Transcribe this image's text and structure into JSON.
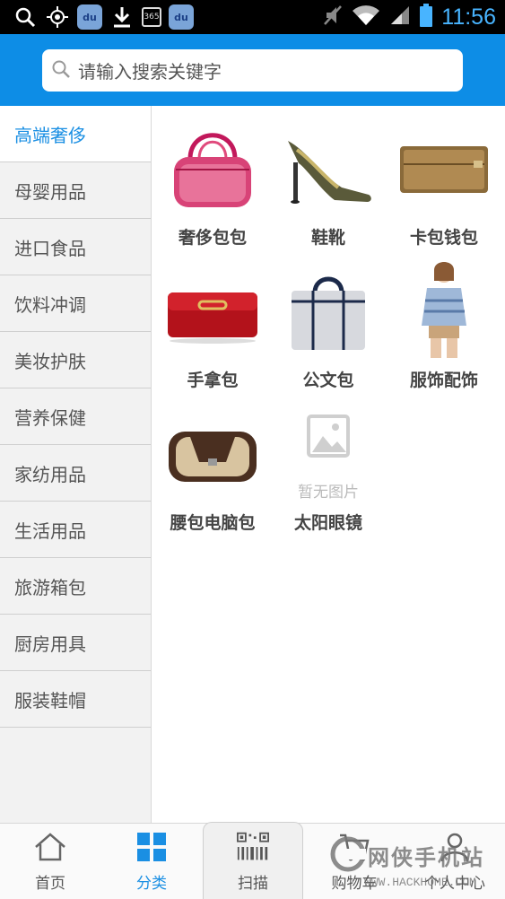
{
  "statusbar": {
    "time": "11:56",
    "calendar_num": "365",
    "baidu_text": "du"
  },
  "search": {
    "placeholder": "请输入搜索关键字"
  },
  "sidebar": {
    "items": [
      {
        "label": "高端奢侈",
        "active": true
      },
      {
        "label": "母婴用品"
      },
      {
        "label": "进口食品"
      },
      {
        "label": "饮料冲调"
      },
      {
        "label": "美妆护肤"
      },
      {
        "label": "营养保健"
      },
      {
        "label": "家纺用品"
      },
      {
        "label": "生活用品"
      },
      {
        "label": "旅游箱包"
      },
      {
        "label": "厨房用具"
      },
      {
        "label": "服装鞋帽"
      }
    ]
  },
  "grid": {
    "items": [
      {
        "label": "奢侈包包",
        "icon": "handbag-image"
      },
      {
        "label": "鞋靴",
        "icon": "high-heel-image"
      },
      {
        "label": "卡包钱包",
        "icon": "wallet-image"
      },
      {
        "label": "手拿包",
        "icon": "clutch-image"
      },
      {
        "label": "公文包",
        "icon": "briefcase-image"
      },
      {
        "label": "服饰配饰",
        "icon": "model-image"
      },
      {
        "label": "腰包电脑包",
        "icon": "waist-bag-image"
      },
      {
        "label": "太阳眼镜",
        "icon": "no-image-placeholder",
        "placeholder_text": "暂无图片"
      }
    ]
  },
  "bottomnav": {
    "items": [
      {
        "label": "首页",
        "icon": "home-icon"
      },
      {
        "label": "分类",
        "icon": "category-icon",
        "active": true
      },
      {
        "label": "扫描",
        "icon": "qr-scan-icon"
      },
      {
        "label": "购物车",
        "icon": "cart-icon"
      },
      {
        "label": "个人中心",
        "icon": "user-icon"
      }
    ]
  },
  "watermark": {
    "text": "网侠手机站",
    "url": "WWW.HACKHOME.COM"
  },
  "colors": {
    "accent": "#0d8de6",
    "active_text": "#1a8fe3",
    "sidebar_bg": "#f2f2f2"
  }
}
